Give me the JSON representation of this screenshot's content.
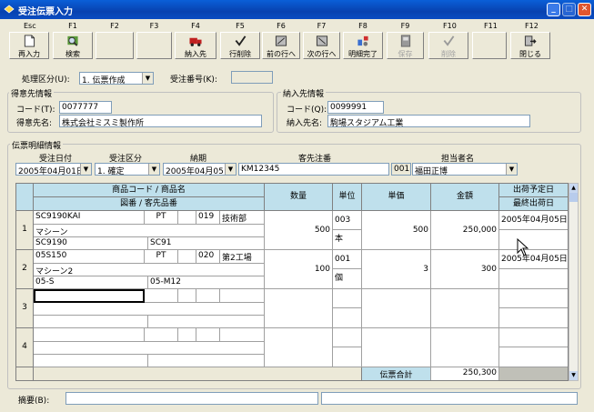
{
  "window": {
    "title": "受注伝票入力"
  },
  "toolbar": [
    {
      "key": "Esc",
      "label": "再入力",
      "icon": "document-icon",
      "enabled": true
    },
    {
      "key": "F1",
      "label": "検索",
      "icon": "search-icon",
      "enabled": true
    },
    {
      "key": "F2",
      "label": "",
      "icon": "",
      "enabled": true
    },
    {
      "key": "F3",
      "label": "",
      "icon": "",
      "enabled": true
    },
    {
      "key": "F4",
      "label": "納入先",
      "icon": "truck-icon",
      "enabled": true
    },
    {
      "key": "F5",
      "label": "行削除",
      "icon": "check-icon",
      "enabled": true
    },
    {
      "key": "F6",
      "label": "前の行へ",
      "icon": "prev-row-icon",
      "enabled": true
    },
    {
      "key": "F7",
      "label": "次の行へ",
      "icon": "next-row-icon",
      "enabled": true
    },
    {
      "key": "F8",
      "label": "明細完了",
      "icon": "detail-complete-icon",
      "enabled": true
    },
    {
      "key": "F9",
      "label": "保存",
      "icon": "save-icon",
      "enabled": false
    },
    {
      "key": "F10",
      "label": "削除",
      "icon": "delete-check-icon",
      "enabled": false
    },
    {
      "key": "F11",
      "label": "",
      "icon": "",
      "enabled": true
    },
    {
      "key": "F12",
      "label": "閉じる",
      "icon": "close-door-icon",
      "enabled": true
    }
  ],
  "header": {
    "mode_label": "処理区分(U):",
    "mode_value": "1. 伝票作成",
    "order_no_label": "受注番号(K):",
    "order_no_value": ""
  },
  "customer": {
    "group_title": "得意先情報",
    "code_label": "コード(T):",
    "code_value": "0077777",
    "name_label": "得意先名:",
    "name_value": "株式会社ミスミ製作所"
  },
  "delivery": {
    "group_title": "納入先情報",
    "code_label": "コード(Q):",
    "code_value": "0099991",
    "name_label": "納入先名:",
    "name_value": "駒場スタジアム工業"
  },
  "detail_info": {
    "group_title": "伝票明細情報",
    "order_date_label": "受注日付",
    "order_date": "2005年04月01日",
    "order_type_label": "受注区分",
    "order_type": "1. 確定",
    "due_label": "納期",
    "due_date": "2005年04月05日",
    "cust_order_label": "客先注番",
    "cust_order_no": "KM12345",
    "staff_label": "担当者名",
    "staff_code": "001",
    "staff_name": "福田正博"
  },
  "grid": {
    "headers": {
      "product": "商品コード / 商品名",
      "drawing": "図番 / 客先品番",
      "qty": "数量",
      "unit": "単位",
      "price": "単価",
      "amount": "金額",
      "ship_plan": "出荷予定日",
      "last_ship": "最終出荷日"
    },
    "rows": [
      {
        "no": "1",
        "code": "SC9190KAI",
        "pt": "PT",
        "wh": "019",
        "dept": "技術部",
        "name": "マシーン",
        "drawing": "SC9190",
        "cust_part": "SC91",
        "qty": "500",
        "unit_code": "003",
        "unit": "本",
        "price": "500",
        "amount": "250,000",
        "ship_date": "2005年04月05日"
      },
      {
        "no": "2",
        "code": "05S150",
        "pt": "PT",
        "wh": "020",
        "dept": "第2工場",
        "name": "マシーン2",
        "drawing": "05-S",
        "cust_part": "05-M12",
        "qty": "100",
        "unit_code": "001",
        "unit": "個",
        "price": "3",
        "amount": "300",
        "ship_date": "2005年04月05日"
      },
      {
        "no": "3",
        "code": "",
        "pt": "",
        "wh": "",
        "dept": "",
        "name": "",
        "drawing": "",
        "cust_part": "",
        "qty": "",
        "unit_code": "",
        "unit": "",
        "price": "",
        "amount": "",
        "ship_date": ""
      },
      {
        "no": "4",
        "code": "",
        "pt": "",
        "wh": "",
        "dept": "",
        "name": "",
        "drawing": "",
        "cust_part": "",
        "qty": "",
        "unit_code": "",
        "unit": "",
        "price": "",
        "amount": "",
        "ship_date": ""
      }
    ],
    "total_label": "伝票合計",
    "total_value": "250,300"
  },
  "footer": {
    "memo_label": "摘要(B):"
  }
}
